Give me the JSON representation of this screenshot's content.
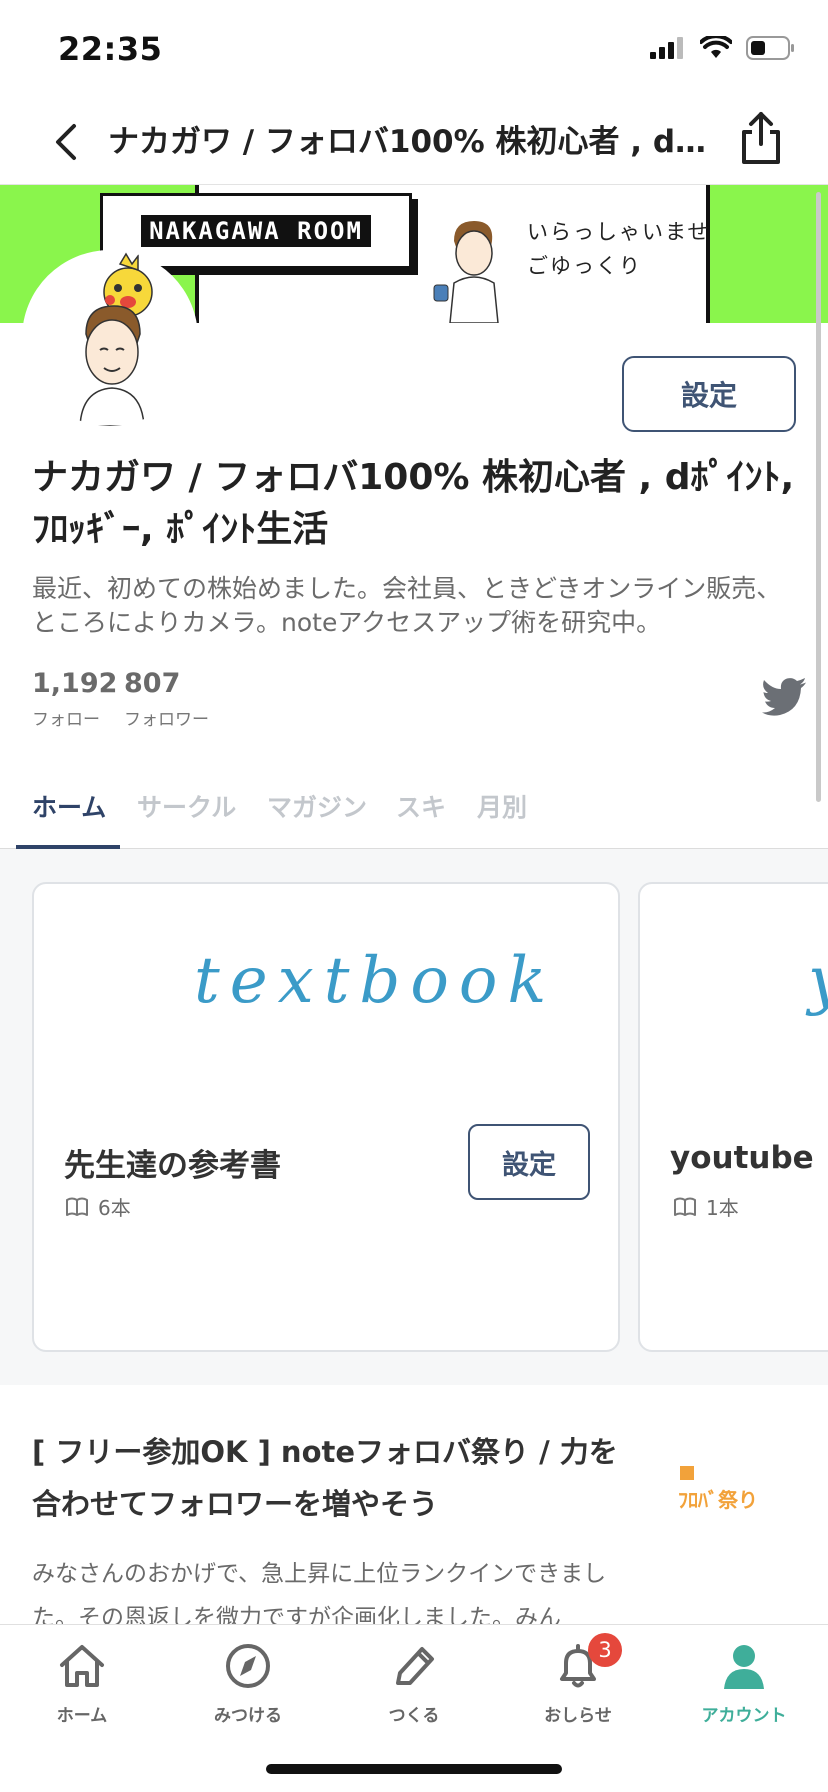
{
  "status_bar": {
    "time": "22:35"
  },
  "nav": {
    "title": "ナカガワ / フォロバ100% 株初心者 , d..."
  },
  "banner": {
    "logo_text": "NAKAGAWA ROOM",
    "greeting_line1": "いらっしゃいませ",
    "greeting_line2": "ごゆっくり",
    "color": "#8af54c"
  },
  "profile": {
    "settings_label": "設定",
    "name": "ナカガワ / フォロバ100% 株初心者 , dﾎﾟｲﾝﾄ, ﾌﾛｯｷﾞｰ, ﾎﾟｲﾝﾄ生活",
    "bio": "最近、初めての株始めました。会社員、ときどきオンライン販売、ところによりカメラ。noteアクセスアップ術を研究中。",
    "follow_count": "1,192",
    "follow_label": "フォロー",
    "follower_count": "807",
    "follower_label": "フォロワー"
  },
  "tabs": [
    {
      "label": "ホーム",
      "active": true
    },
    {
      "label": "サークル",
      "active": false
    },
    {
      "label": "マガジン",
      "active": false
    },
    {
      "label": "スキ",
      "active": false
    },
    {
      "label": "月別",
      "active": false
    }
  ],
  "magazines": [
    {
      "cover_text": "textbook",
      "title": "先生達の参考書",
      "count": "6本",
      "settings_label": "設定"
    },
    {
      "cover_text": "y",
      "title": "youtube",
      "count": "1本"
    }
  ],
  "article": {
    "title": "[ フリー参加OK ] noteフォロバ祭り / 力を合わせてフォロワーを増やそう",
    "body": "みなさんのおかげで、急上昇に上位ランクインできました。その恩返しを微力ですが企画化しました。みん",
    "thumb_text": "ﾌﾛﾊﾞ祭り"
  },
  "bottom_bar": {
    "items": [
      {
        "label": "ホーム",
        "icon": "home-icon"
      },
      {
        "label": "みつける",
        "icon": "compass-icon"
      },
      {
        "label": "つくる",
        "icon": "pencil-icon"
      },
      {
        "label": "おしらせ",
        "icon": "bell-icon",
        "badge": "3"
      },
      {
        "label": "アカウント",
        "icon": "account-icon",
        "active": true
      }
    ]
  },
  "colors": {
    "accent_navy": "#2f4368",
    "active_green": "#3fae9a",
    "badge_red": "#e5483c"
  }
}
